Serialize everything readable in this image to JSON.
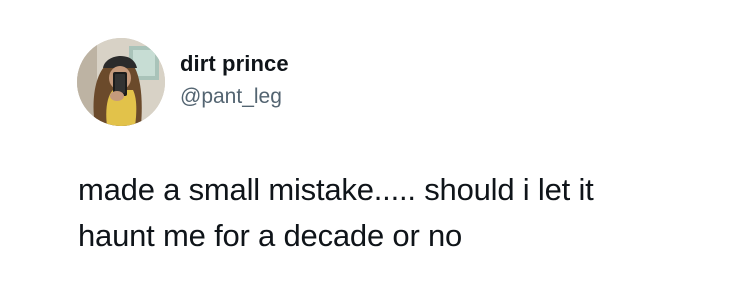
{
  "tweet": {
    "author": {
      "display_name": "dirt prince",
      "handle": "@pant_leg",
      "avatar_icon": "profile-photo"
    },
    "text": "made a small mistake..... should i let it\nhaunt me for a decade or no"
  },
  "colors": {
    "background": "#ffffff",
    "text_primary": "#0f1419",
    "text_secondary": "#536471"
  }
}
